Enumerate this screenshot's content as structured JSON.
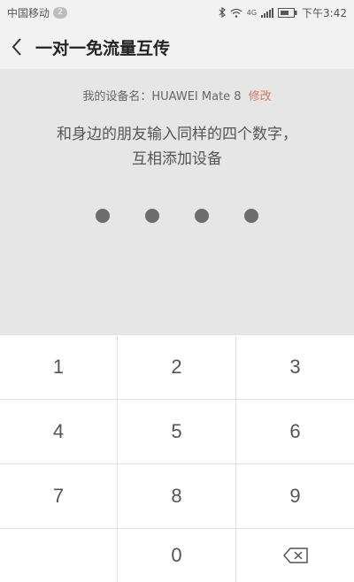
{
  "status_bar": {
    "carrier": "中国移动",
    "badge": "2",
    "time": "下午3:42",
    "network": "4G",
    "icons": [
      "bluetooth-icon",
      "wifi-icon",
      "signal-icon",
      "battery-icon"
    ]
  },
  "header": {
    "title": "一对一免流量互传",
    "back_icon": "chevron-left-icon"
  },
  "device": {
    "label": "我的设备名：",
    "name": "HUAWEI Mate 8",
    "edit": "修改"
  },
  "instruction": {
    "line1": "和身边的朋友输入同样的四个数字，",
    "line2": "互相添加设备"
  },
  "pin": {
    "length": 4,
    "entered": 4
  },
  "keypad": {
    "keys": [
      "1",
      "2",
      "3",
      "4",
      "5",
      "6",
      "7",
      "8",
      "9",
      "",
      "0",
      ""
    ]
  },
  "colors": {
    "accent": "#e2735b",
    "dot": "#6b6e6a",
    "panel": "#e6e6e6"
  }
}
